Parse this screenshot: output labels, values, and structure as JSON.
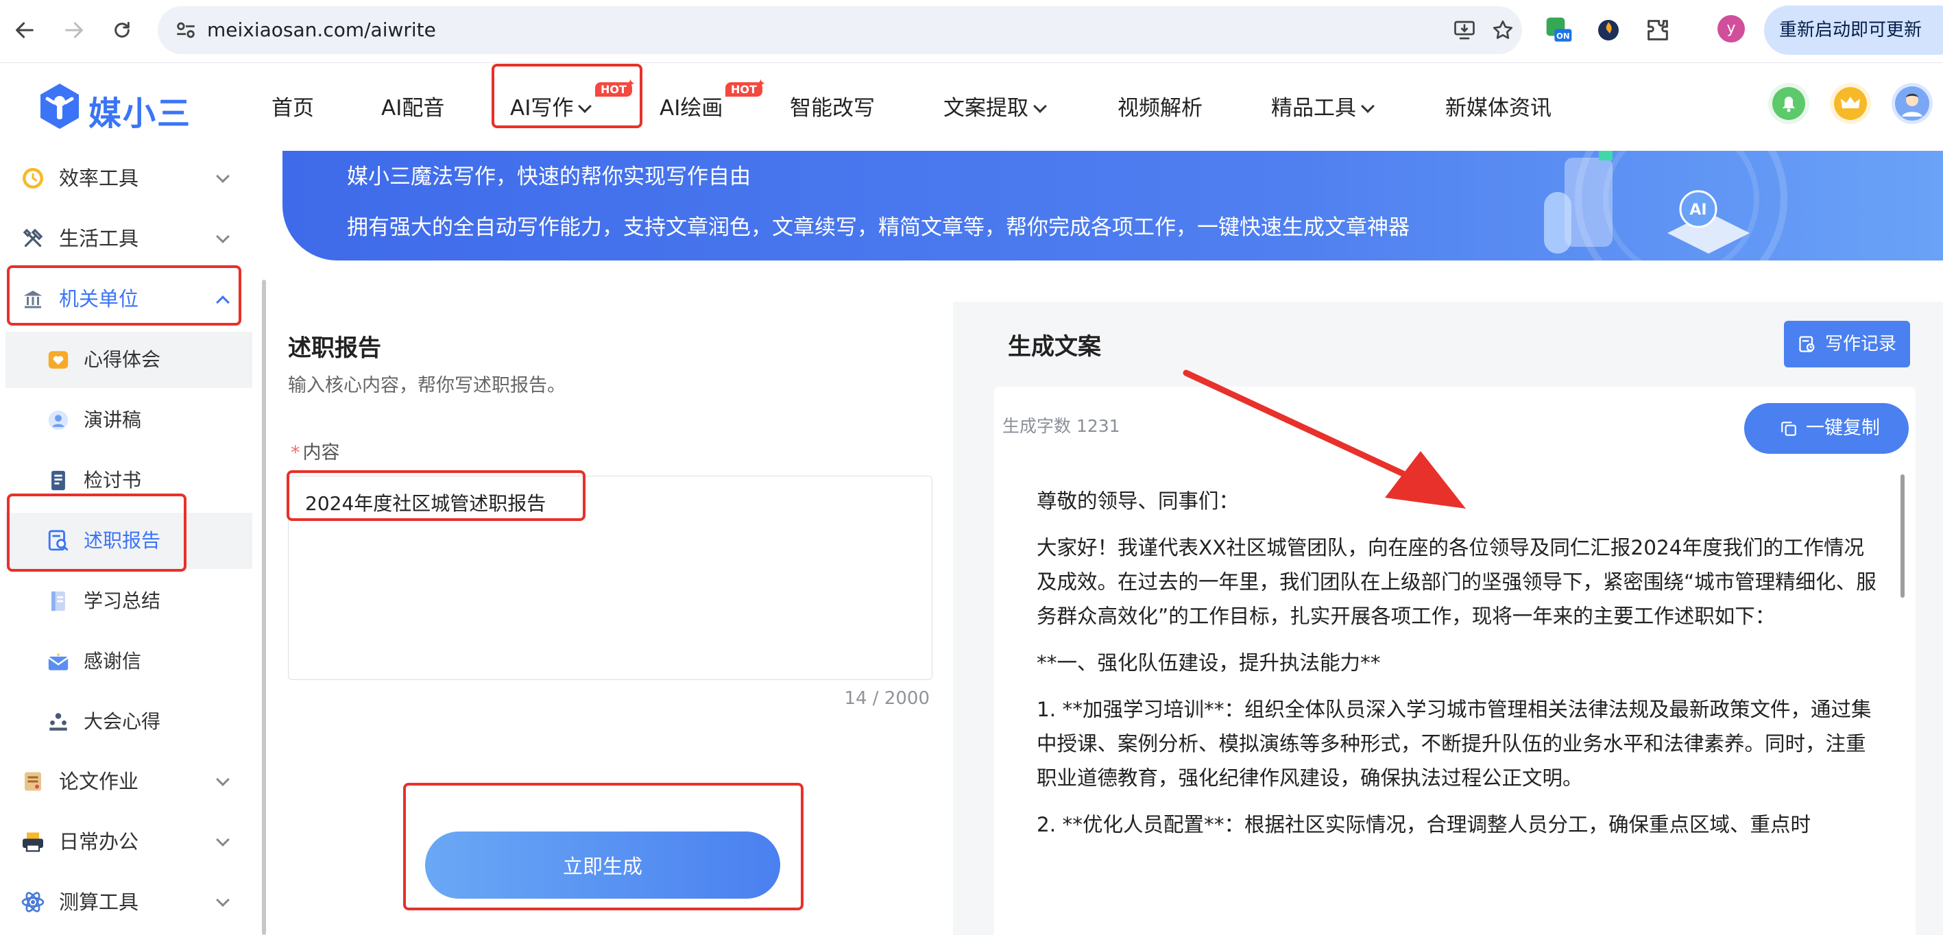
{
  "browser": {
    "url": "meixiaosan.com/aiwrite",
    "profile_initial": "y",
    "relaunch_label": "重新启动即可更新",
    "extension_badge": "ON"
  },
  "site": {
    "logo_text": "媒小三",
    "nav": [
      {
        "label": "首页"
      },
      {
        "label": "AI配音"
      },
      {
        "label": "AI写作",
        "badge": "HOT"
      },
      {
        "label": "AI绘画",
        "badge": "HOT"
      },
      {
        "label": "智能改写"
      },
      {
        "label": "文案提取"
      },
      {
        "label": "视频解析"
      },
      {
        "label": "精品工具"
      },
      {
        "label": "新媒体资讯"
      }
    ]
  },
  "sidebar": {
    "groups": [
      {
        "label": "效率工具"
      },
      {
        "label": "生活工具"
      },
      {
        "label": "机关单位"
      }
    ],
    "sub_items": [
      {
        "label": "心得体会"
      },
      {
        "label": "演讲稿"
      },
      {
        "label": "检讨书"
      },
      {
        "label": "述职报告"
      },
      {
        "label": "学习总结"
      },
      {
        "label": "感谢信"
      },
      {
        "label": "大会心得"
      }
    ],
    "groups_after": [
      {
        "label": "论文作业"
      },
      {
        "label": "日常办公"
      },
      {
        "label": "测算工具"
      }
    ]
  },
  "banner": {
    "line1": "媒小三魔法写作，快速的帮你实现写作自由",
    "line2": "拥有强大的全自动写作能力，支持文章润色，文章续写，精简文章等，帮你完成各项工作，一键快速生成文章神器"
  },
  "form": {
    "title": "述职报告",
    "description": "输入核心内容，帮你写述职报告。",
    "required_mark": "*",
    "field_label": "内容",
    "content_value": "2024年度社区城管述职报告",
    "counter": "14 / 2000",
    "generate_label": "立即生成"
  },
  "output": {
    "title": "生成文案",
    "history_label": "写作记录",
    "word_count": "生成字数 1231",
    "copy_label": "一键复制",
    "paragraphs": [
      "尊敬的领导、同事们：",
      "大家好！我谨代表XX社区城管团队，向在座的各位领导及同仁汇报2024年度我们的工作情况及成效。在过去的一年里，我们团队在上级部门的坚强领导下，紧密围绕“城市管理精细化、服务群众高效化”的工作目标，扎实开展各项工作，现将一年来的主要工作述职如下：",
      "**一、强化队伍建设，提升执法能力**",
      "1. **加强学习培训**：组织全体队员深入学习城市管理相关法律法规及最新政策文件，通过集中授课、案例分析、模拟演练等多种形式，不断提升队伍的业务水平和法律素养。同时，注重职业道德教育，强化纪律作风建设，确保执法过程公正文明。",
      "2. **优化人员配置**：根据社区实际情况，合理调整人员分工，确保重点区域、重点时"
    ]
  },
  "colors": {
    "brand": "#3b74f6",
    "annotation": "#e8312a",
    "hot_badge": "#f5483f"
  }
}
